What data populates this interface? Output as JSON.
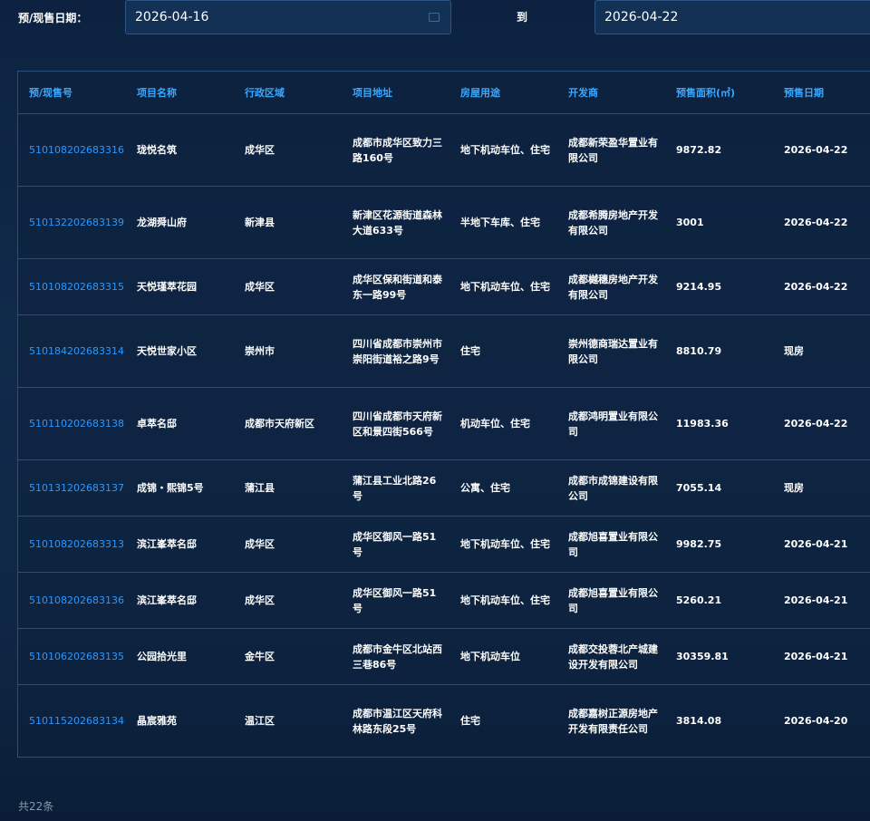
{
  "filter": {
    "label": "预/现售日期：",
    "start_date": "2026-04-16",
    "separator": "到",
    "end_date": "2026-04-22"
  },
  "table": {
    "headers": [
      "预/现售号",
      "项目名称",
      "行政区域",
      "项目地址",
      "房屋用途",
      "开发商",
      "预售面积(㎡)",
      "预售日期"
    ],
    "rows": [
      [
        "510108202683316",
        "珑悦名筑",
        "成华区",
        "成都市成华区致力三路160号",
        "地下机动车位、住宅",
        "成都新荣盈华置业有限公司",
        "9872.82",
        "2026-04-22"
      ],
      [
        "510132202683139",
        "龙湖舜山府",
        "新津县",
        "新津区花源街道森林大道633号",
        "半地下车库、住宅",
        "成都希腾房地产开发有限公司",
        "3001",
        "2026-04-22"
      ],
      [
        "510108202683315",
        "天悦瑾萃花园",
        "成华区",
        "成华区保和街道和泰东一路99号",
        "地下机动车位、住宅",
        "成都樾穗房地产开发有限公司",
        "9214.95",
        "2026-04-22"
      ],
      [
        "510184202683314",
        "天悦世家小区",
        "崇州市",
        "四川省成都市崇州市崇阳街道裕之路9号",
        "住宅",
        "崇州德商瑞达置业有限公司",
        "8810.79",
        "现房"
      ],
      [
        "510110202683138",
        "卓萃名邸",
        "成都市天府新区",
        "四川省成都市天府新区和景四街566号",
        "机动车位、住宅",
        "成都鸿明置业有限公司",
        "11983.36",
        "2026-04-22"
      ],
      [
        "510131202683137",
        "成锦・熙锦5号",
        "蒲江县",
        "蒲江县工业北路26号",
        "公寓、住宅",
        "成都市成锦建设有限公司",
        "7055.14",
        "现房"
      ],
      [
        "510108202683313",
        "滨江峯萃名邸",
        "成华区",
        "成华区御风一路51号",
        "地下机动车位、住宅",
        "成都旭喜置业有限公司",
        "9982.75",
        "2026-04-21"
      ],
      [
        "510108202683136",
        "滨江峯萃名邸",
        "成华区",
        "成华区御风一路51号",
        "地下机动车位、住宅",
        "成都旭喜置业有限公司",
        "5260.21",
        "2026-04-21"
      ],
      [
        "510106202683135",
        "公园拾光里",
        "金牛区",
        "成都市金牛区北站西三巷86号",
        "地下机动车位",
        "成都交投蓉北产城建设开发有限公司",
        "30359.81",
        "2026-04-21"
      ],
      [
        "510115202683134",
        "晶宸雅苑",
        "温江区",
        "成都市温江区天府科林路东段25号",
        "住宅",
        "成都嘉树正源房地产开发有限责任公司",
        "3814.08",
        "2026-04-20"
      ]
    ]
  },
  "footer": {
    "total": "共22条"
  }
}
